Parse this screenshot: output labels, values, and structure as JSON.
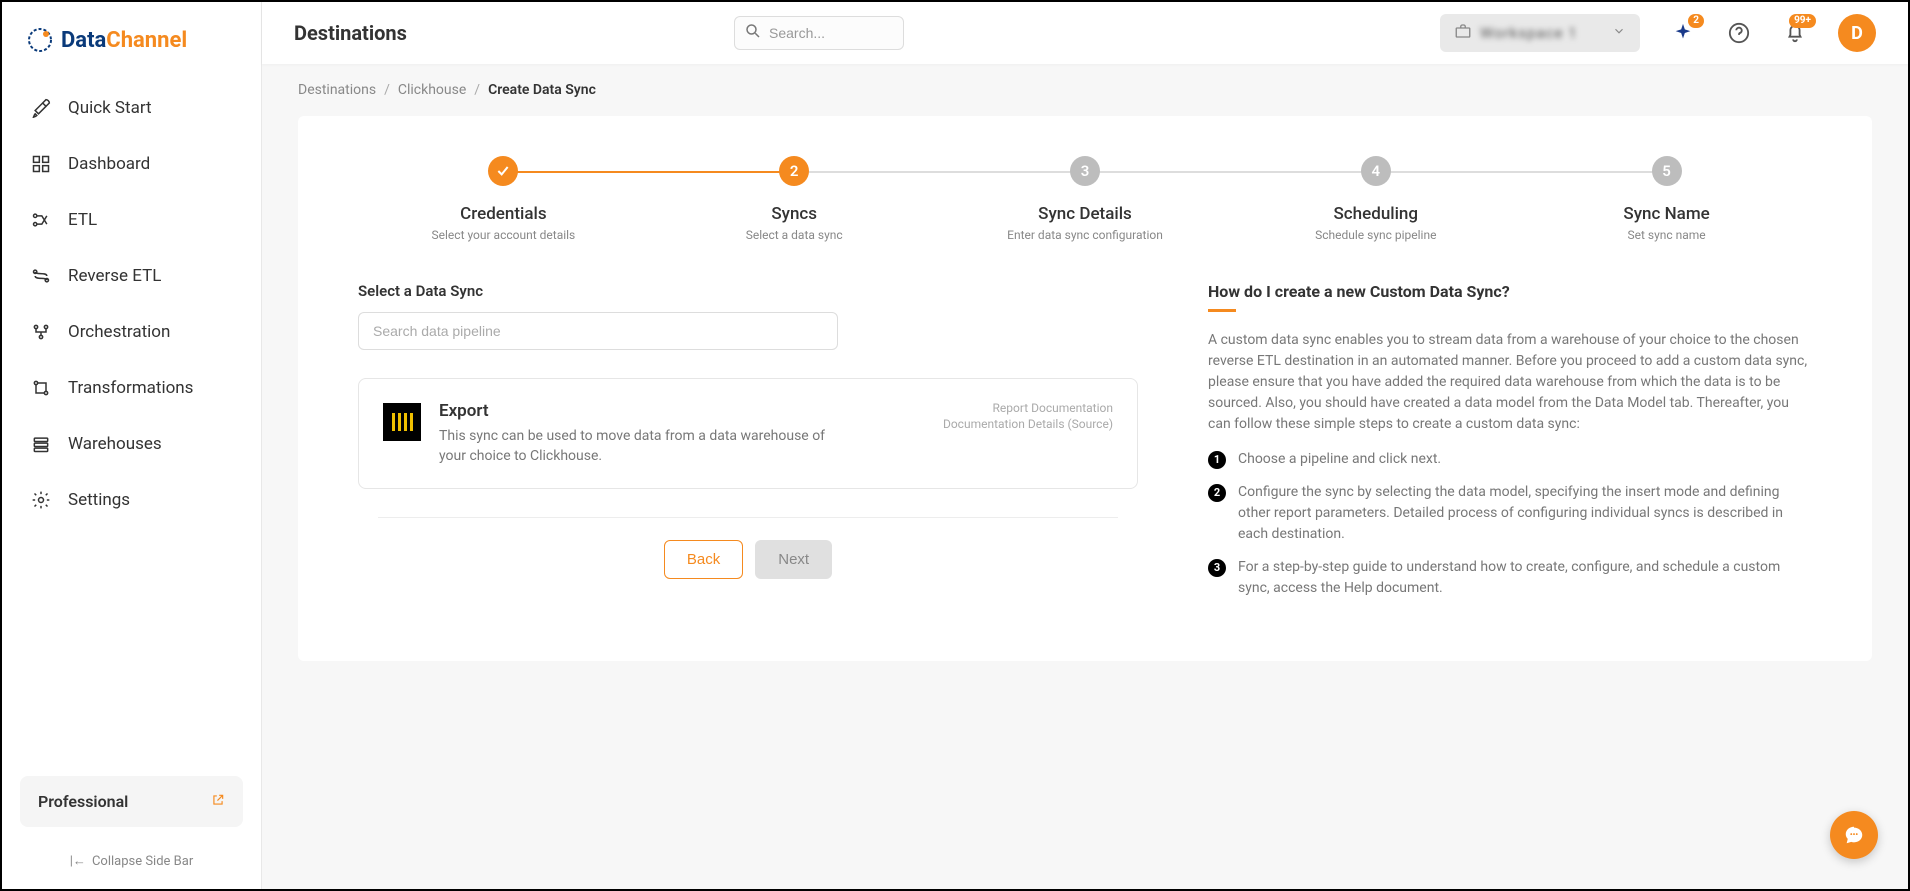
{
  "logo": {
    "data": "Data",
    "channel": "Channel"
  },
  "sidebar": {
    "items": [
      {
        "label": "Quick Start"
      },
      {
        "label": "Dashboard"
      },
      {
        "label": "ETL"
      },
      {
        "label": "Reverse ETL"
      },
      {
        "label": "Orchestration"
      },
      {
        "label": "Transformations"
      },
      {
        "label": "Warehouses"
      },
      {
        "label": "Settings"
      }
    ],
    "plan_label": "Professional",
    "collapse_label": "Collapse Side Bar"
  },
  "header": {
    "title": "Destinations",
    "search_placeholder": "Search...",
    "workspace_name": "Workspace 1",
    "sparkle_badge": "2",
    "bell_badge": "99+",
    "avatar_initial": "D"
  },
  "breadcrumb": {
    "items": [
      "Destinations",
      "Clickhouse",
      "Create Data Sync"
    ]
  },
  "stepper": [
    {
      "title": "Credentials",
      "desc": "Select your account details",
      "state": "completed"
    },
    {
      "title": "Syncs",
      "desc": "Select a data sync",
      "state": "active",
      "num": "2"
    },
    {
      "title": "Sync Details",
      "desc": "Enter data sync configuration",
      "state": "pending",
      "num": "3"
    },
    {
      "title": "Scheduling",
      "desc": "Schedule sync pipeline",
      "state": "pending",
      "num": "4"
    },
    {
      "title": "Sync Name",
      "desc": "Set sync name",
      "state": "pending",
      "num": "5"
    }
  ],
  "section": {
    "select_label": "Select a Data Sync",
    "search_placeholder": "Search data pipeline"
  },
  "sync_card": {
    "title": "Export",
    "desc": "This sync can be used to move data from a data warehouse of your choice to Clickhouse.",
    "link1": "Report Documentation",
    "link2": "Documentation Details (Source)"
  },
  "buttons": {
    "back": "Back",
    "next": "Next"
  },
  "help": {
    "title": "How do I create a new Custom Data Sync?",
    "intro": "A custom data sync enables you to stream data from a warehouse of your choice to the chosen reverse ETL destination in an automated manner. Before you proceed to add a custom data sync, please ensure that you have added the required data warehouse from which the data is to be sourced. Also, you should have created a data model from the Data Model tab. Thereafter, you can follow these simple steps to create a custom data sync:",
    "steps": [
      "Choose a pipeline and click next.",
      "Configure the sync by selecting the data model, specifying the insert mode and defining other report parameters. Detailed process of configuring individual syncs is described in each destination.",
      "For a step-by-step guide to understand how to create, configure, and schedule a custom sync, access the Help document."
    ]
  }
}
